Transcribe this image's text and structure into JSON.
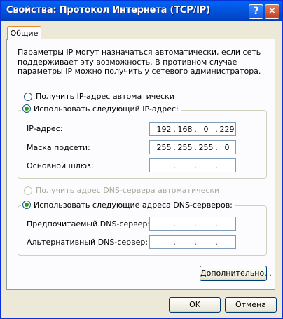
{
  "window": {
    "title": "Свойства: Протокол Интернета (TCP/IP)",
    "help_glyph": "?",
    "close_glyph": "✕"
  },
  "tab": {
    "label": "Общие"
  },
  "description": "Параметры IP могут назначаться автоматически, если сеть поддерживает эту возможность. В противном случае параметры IP можно получить у сетевого администратора.",
  "ip": {
    "auto_label": "Получить IP-адрес автоматически",
    "manual_label": "Использовать следующий IP-адрес:",
    "selected": "manual",
    "address_label": "IP-адрес:",
    "address": [
      "192",
      "168",
      "0",
      "229"
    ],
    "mask_label": "Маска подсети:",
    "mask": [
      "255",
      "255",
      "255",
      "0"
    ],
    "gateway_label": "Основной шлюз:",
    "gateway": [
      "",
      "",
      "",
      ""
    ]
  },
  "dns": {
    "auto_label": "Получить адрес DNS-сервера автоматически",
    "manual_label": "Использовать следующие адреса DNS-серверов:",
    "selected": "manual",
    "preferred_label": "Предпочитаемый DNS-сервер:",
    "preferred": [
      "",
      "",
      "",
      ""
    ],
    "alternate_label": "Альтернативный DNS-сервер:",
    "alternate": [
      "",
      "",
      "",
      ""
    ]
  },
  "buttons": {
    "advanced": "Дополнительно...",
    "ok": "OK",
    "cancel": "Отмена"
  },
  "ip_separator": "."
}
